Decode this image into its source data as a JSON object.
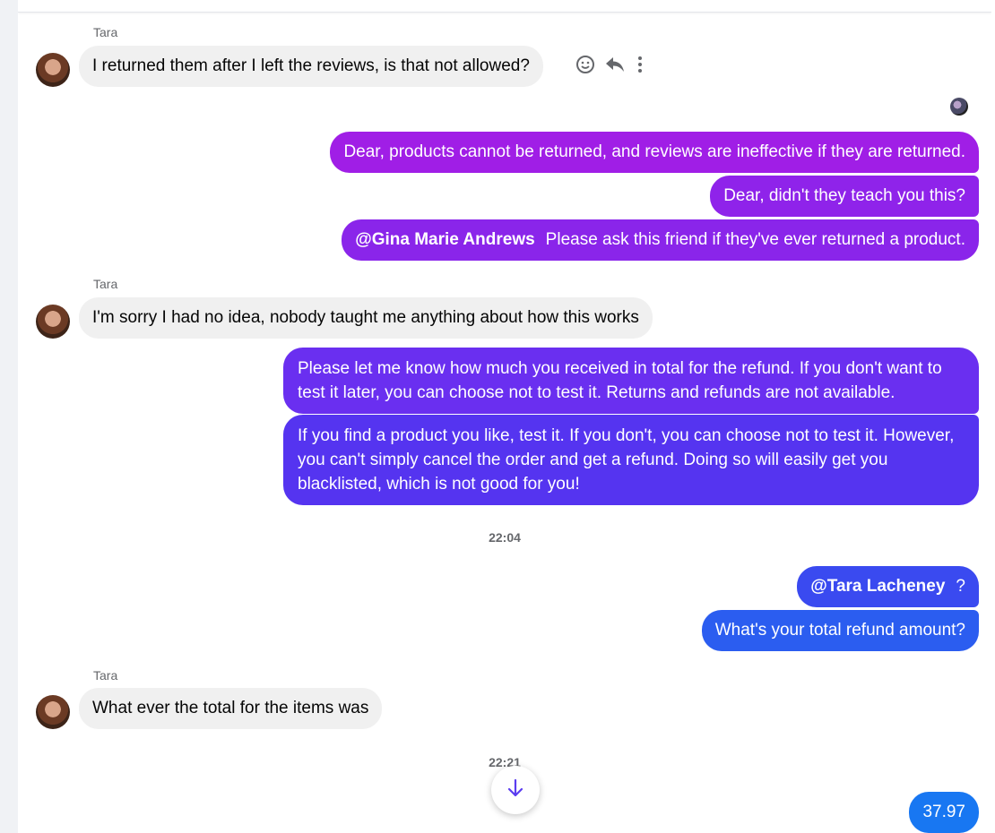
{
  "messages": {
    "m1": {
      "sender": "Tara",
      "text": "I returned them after I left the reviews, is that not allowed?"
    },
    "m2": {
      "text": "Dear, products cannot be returned, and reviews are ineffective if they are returned."
    },
    "m3": {
      "text": "Dear, didn't they teach you this?"
    },
    "m4": {
      "mention": "@Gina Marie Andrews",
      "text": "Please ask this friend if they've ever returned a product."
    },
    "m5": {
      "sender": "Tara",
      "text": "I'm sorry I had no idea, nobody taught me anything about how this works"
    },
    "m6": {
      "text": "Please let me know how much you received in total for the refund. If you don't want to test it later, you can choose not to test it. Returns and refunds are not available."
    },
    "m7": {
      "text": "If you find a product you like, test it. If you don't, you can choose not to test it. However, you can't simply cancel the order and get a refund. Doing so will easily get you blacklisted, which is not good for you!"
    },
    "time1": "22:04",
    "m8": {
      "mention": "@Tara Lacheney",
      "text": "?"
    },
    "m9": {
      "text": "What's your total refund amount?"
    },
    "m10": {
      "sender": "Tara",
      "text": "What ever the total for the items was"
    },
    "time2": "22:21",
    "m11": {
      "text": "37.97"
    }
  },
  "icons": {
    "react": "smiley-icon",
    "reply": "reply-icon",
    "more": "more-vertical-icon",
    "scroll": "arrow-down-icon"
  },
  "colors": {
    "incoming": "#f0f0f0",
    "outgoing_purple": "#a01ee6",
    "outgoing_violet": "#6a2ff0",
    "outgoing_blue": "#2b5df0",
    "timestamp": "#65676b"
  }
}
